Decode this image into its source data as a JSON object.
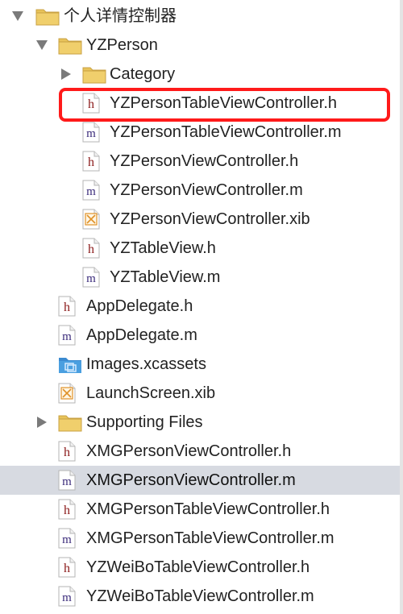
{
  "navigator": {
    "rows": [
      {
        "label": "个人详情控制器",
        "type": "group",
        "expanded": true,
        "depth": 0,
        "selected": false
      },
      {
        "label": "YZPerson",
        "type": "group",
        "expanded": true,
        "depth": 1,
        "selected": false
      },
      {
        "label": "Category",
        "type": "group",
        "expanded": false,
        "depth": 2,
        "selected": false
      },
      {
        "label": "YZPersonTableViewController.h",
        "type": "h",
        "depth": 2,
        "selected": false,
        "highlighted": true
      },
      {
        "label": "YZPersonTableViewController.m",
        "type": "m",
        "depth": 2,
        "selected": false
      },
      {
        "label": "YZPersonViewController.h",
        "type": "h",
        "depth": 2,
        "selected": false
      },
      {
        "label": "YZPersonViewController.m",
        "type": "m",
        "depth": 2,
        "selected": false
      },
      {
        "label": "YZPersonViewController.xib",
        "type": "xib",
        "depth": 2,
        "selected": false
      },
      {
        "label": "YZTableView.h",
        "type": "h",
        "depth": 2,
        "selected": false
      },
      {
        "label": "YZTableView.m",
        "type": "m",
        "depth": 2,
        "selected": false
      },
      {
        "label": "AppDelegate.h",
        "type": "h",
        "depth": 1,
        "selected": false
      },
      {
        "label": "AppDelegate.m",
        "type": "m",
        "depth": 1,
        "selected": false
      },
      {
        "label": "Images.xcassets",
        "type": "xcassets",
        "depth": 1,
        "selected": false
      },
      {
        "label": "LaunchScreen.xib",
        "type": "xib",
        "depth": 1,
        "selected": false
      },
      {
        "label": "Supporting Files",
        "type": "group",
        "expanded": false,
        "depth": 1,
        "selected": false
      },
      {
        "label": "XMGPersonViewController.h",
        "type": "h",
        "depth": 1,
        "selected": false
      },
      {
        "label": "XMGPersonViewController.m",
        "type": "m",
        "depth": 1,
        "selected": true
      },
      {
        "label": "XMGPersonTableViewController.h",
        "type": "h",
        "depth": 1,
        "selected": false
      },
      {
        "label": "XMGPersonTableViewController.m",
        "type": "m",
        "depth": 1,
        "selected": false
      },
      {
        "label": "YZWeiBoTableViewController.h",
        "type": "h",
        "depth": 1,
        "selected": false
      },
      {
        "label": "YZWeiBoTableViewController.m",
        "type": "m",
        "depth": 1,
        "selected": false
      }
    ]
  },
  "icons": {
    "h": "header-file-icon",
    "m": "implementation-file-icon",
    "xib": "interface-builder-file-icon",
    "xcassets": "asset-catalog-icon",
    "group": "folder-icon"
  },
  "colors": {
    "folder": "#e8c35a",
    "h_letter": "#8b1a1a",
    "m_letter": "#3a2a7a",
    "xib_x": "#e0922a",
    "xcassets": "#4a9fe0",
    "selection": "#d7dae1",
    "highlight_box": "#ff1a1a"
  }
}
